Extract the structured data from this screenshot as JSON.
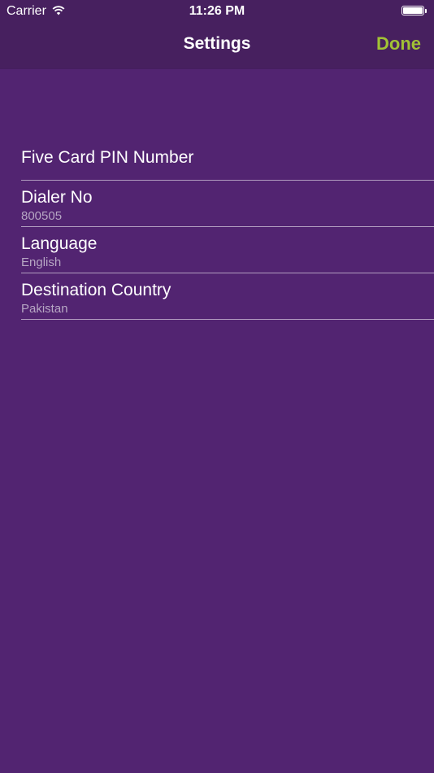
{
  "status_bar": {
    "carrier": "Carrier",
    "time": "11:26 PM",
    "icons": [
      "wifi-icon",
      "battery-icon"
    ]
  },
  "nav": {
    "title": "Settings",
    "done_label": "Done",
    "done_color": "#a2c235"
  },
  "colors": {
    "background": "#522471",
    "bar": "#47205f",
    "subtitle": "#b7a7c4"
  },
  "settings": [
    {
      "title": "Five Card PIN Number",
      "subtitle": ""
    },
    {
      "title": "Dialer No",
      "subtitle": "800505"
    },
    {
      "title": "Language",
      "subtitle": "English"
    },
    {
      "title": "Destination Country",
      "subtitle": "Pakistan"
    }
  ]
}
